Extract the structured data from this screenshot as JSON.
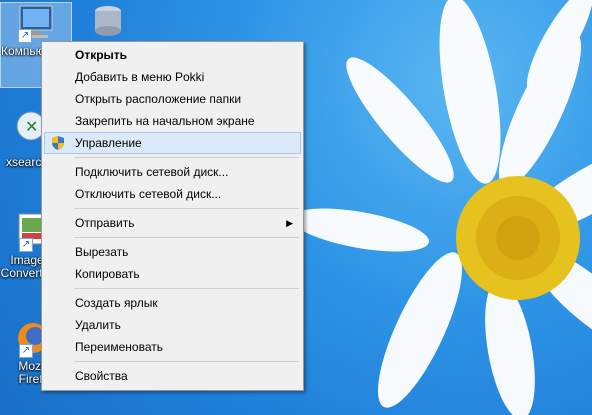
{
  "desktop": {
    "icons": [
      {
        "label": "Компьютер - Ярлык",
        "icon": "computer-icon"
      },
      {
        "label": "",
        "icon": "database-icon"
      },
      {
        "label": "xsearch",
        "icon": "xsearch-icon"
      },
      {
        "label": "Image Converter",
        "icon": "image-converter-icon"
      },
      {
        "label": "Mozilla Firefox",
        "icon": "firefox-icon"
      }
    ]
  },
  "context_menu": {
    "groups": [
      [
        "Открыть",
        "Добавить в меню Pokki",
        "Открыть расположение папки",
        "Закрепить на начальном экране",
        "Управление"
      ],
      [
        "Подключить сетевой диск...",
        "Отключить сетевой диск..."
      ],
      [
        "Отправить"
      ],
      [
        "Вырезать",
        "Копировать"
      ],
      [
        "Создать ярлык",
        "Удалить",
        "Переименовать"
      ],
      [
        "Свойства"
      ]
    ],
    "highlighted": "Управление",
    "default_item": "Открыть",
    "submenu_arrow": "▶"
  },
  "colors": {
    "menu_bg": "#f0f0f0",
    "highlight": "#dbe9f9",
    "wallpaper": "#2f95e6"
  }
}
